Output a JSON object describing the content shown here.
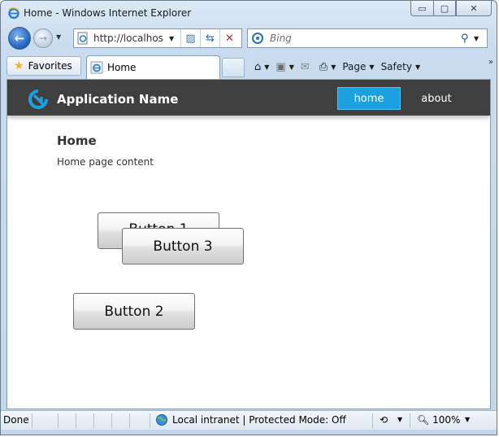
{
  "window": {
    "title": "Home - Windows Internet Explorer",
    "minimize_label": "▭",
    "maximize_label": "▢",
    "close_label": "✕"
  },
  "address_bar": {
    "url": "http://localhost:",
    "search_placeholder": "Bing"
  },
  "toolbar": {
    "favorites_label": "Favorites",
    "tab_label": "Home",
    "page_menu": "Page",
    "safety_menu": "Safety"
  },
  "app": {
    "name": "Application Name",
    "nav_home": "home",
    "nav_about": "about",
    "accent_color": "#1ba1e2",
    "header_color": "#3f3f3f"
  },
  "page": {
    "title": "Home",
    "content": "Home page content",
    "button1": "Button 1",
    "button2": "Button 2",
    "button3": "Button 3"
  },
  "statusbar": {
    "status": "Done",
    "zone": "Local intranet | Protected Mode: Off",
    "zoom": "100%"
  }
}
